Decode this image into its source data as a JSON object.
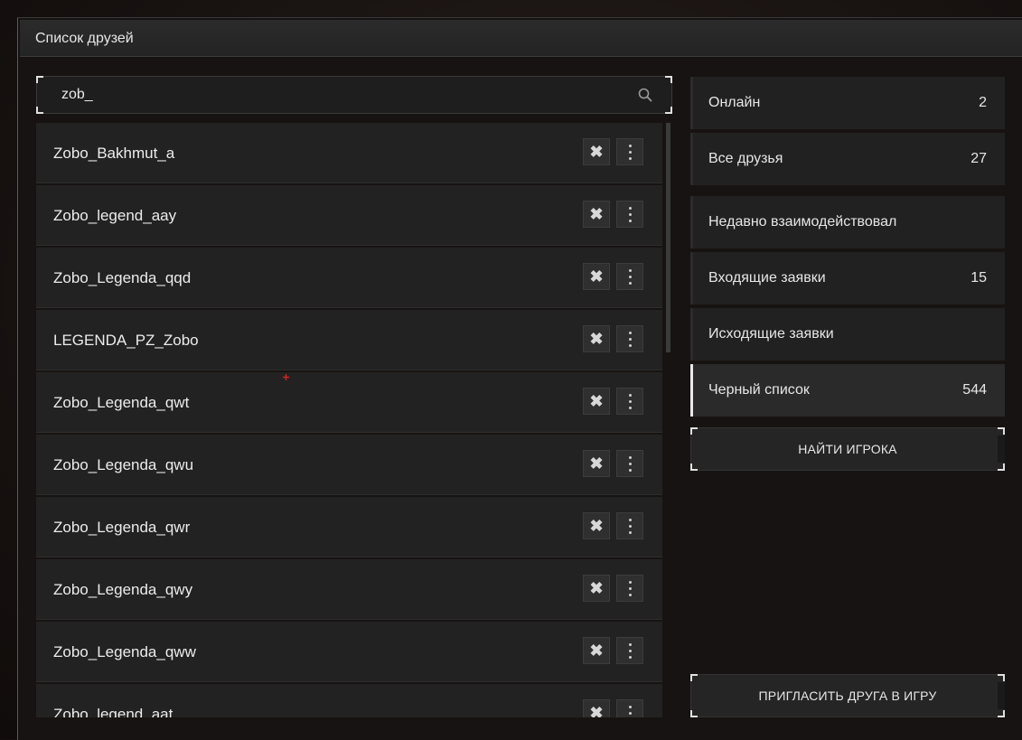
{
  "window": {
    "title": "Список друзей"
  },
  "search": {
    "value": "zob_",
    "placeholder": ""
  },
  "friends": [
    {
      "name": "Zobo_Bakhmut_a"
    },
    {
      "name": "Zobo_legend_aay"
    },
    {
      "name": "Zobo_Legenda_qqd"
    },
    {
      "name": "LEGENDA_PZ_Zobo"
    },
    {
      "name": "Zobo_Legenda_qwt"
    },
    {
      "name": "Zobo_Legenda_qwu"
    },
    {
      "name": "Zobo_Legenda_qwr"
    },
    {
      "name": "Zobo_Legenda_qwy"
    },
    {
      "name": "Zobo_Legenda_qww"
    },
    {
      "name": "Zobo_legend_aat"
    }
  ],
  "row_actions": {
    "remove_glyph": "✖",
    "more_icon": "more-vertical-icon"
  },
  "categories": [
    {
      "label": "Онлайн",
      "count": "2"
    },
    {
      "label": "Все друзья",
      "count": "27"
    },
    {
      "label": "Недавно взаимодействовал",
      "count": ""
    },
    {
      "label": "Входящие заявки",
      "count": "15"
    },
    {
      "label": "Исходящие заявки",
      "count": ""
    },
    {
      "label": "Черный список",
      "count": "544",
      "active": true
    }
  ],
  "buttons": {
    "find_player": "НАЙТИ ИГРОКА",
    "invite_friend": "ПРИГЛАСИТЬ ДРУГА В ИГРУ"
  },
  "colors": {
    "active_accent": "#e8e8e8",
    "crosshair": "#e02020"
  }
}
